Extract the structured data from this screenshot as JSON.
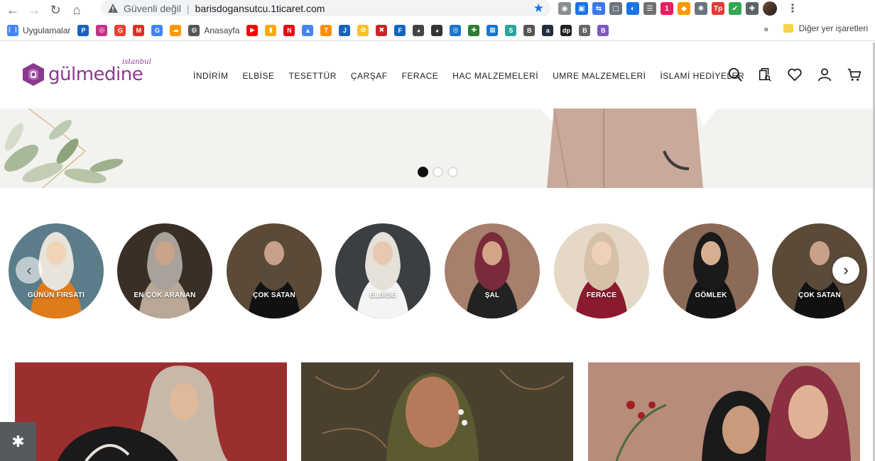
{
  "browser": {
    "nav": {
      "back": "←",
      "forward": "→",
      "reload": "↻",
      "home": "⌂"
    },
    "omnibox": {
      "security_label": "Güvenli değil",
      "separator": "|",
      "url": "barisdogansutcu.1ticaret.com",
      "star": "★"
    },
    "extensions": [
      {
        "name": "camera-ext-icon",
        "color": "#8a8f94",
        "glyph": "◉"
      },
      {
        "name": "screenshot-ext-icon",
        "color": "#1a73e8",
        "glyph": "▣"
      },
      {
        "name": "translate-ext-icon",
        "color": "#3b78e7",
        "glyph": "⇆"
      },
      {
        "name": "window-ext-icon",
        "color": "#6c757d",
        "glyph": "▢"
      },
      {
        "name": "edge-ext-icon",
        "color": "#1a73e8",
        "glyph": "◐"
      },
      {
        "name": "dark-ext-icon",
        "color": "#707070",
        "glyph": "☰"
      },
      {
        "name": "badge-ext-icon",
        "color": "#e91e63",
        "glyph": "1"
      },
      {
        "name": "cube-ext-icon",
        "color": "#ff9800",
        "glyph": "◆"
      },
      {
        "name": "gear-ext-icon",
        "color": "#6c757d",
        "glyph": "✺"
      },
      {
        "name": "tp-ext-icon",
        "color": "#e53935",
        "glyph": "Tp"
      },
      {
        "name": "shield-ext-icon",
        "color": "#34a853",
        "glyph": "✔"
      },
      {
        "name": "puzzle-ext-icon",
        "color": "#5f6368",
        "glyph": "✚"
      }
    ],
    "menu": "⋮",
    "bookmarks": [
      {
        "name": "apps-bookmark",
        "label": "Uygulamalar",
        "color": "#4285f4",
        "glyph": "⋮⋮"
      },
      {
        "name": "bookmark-1",
        "label": "",
        "color": "#1565c0",
        "glyph": "P"
      },
      {
        "name": "instagram-bookmark",
        "label": "",
        "color": "#c13584",
        "glyph": "◎"
      },
      {
        "name": "google-bookmark",
        "label": "",
        "color": "#ea4335",
        "glyph": "G"
      },
      {
        "name": "gmail-bookmark",
        "label": "",
        "color": "#d93025",
        "glyph": "M"
      },
      {
        "name": "translate-bookmark",
        "label": "",
        "color": "#4285f4",
        "glyph": "G"
      },
      {
        "name": "cloud-bookmark",
        "label": "",
        "color": "#ff9800",
        "glyph": "☁"
      },
      {
        "name": "anasayfa-bookmark",
        "label": "Anasayfa",
        "color": "#555",
        "glyph": "◍"
      },
      {
        "name": "youtube-bookmark",
        "label": "",
        "color": "#ff0000",
        "glyph": "▶"
      },
      {
        "name": "analytics-bookmark",
        "label": "",
        "color": "#f9ab00",
        "glyph": "▮"
      },
      {
        "name": "netflix-bookmark",
        "label": "",
        "color": "#e50914",
        "glyph": "N"
      },
      {
        "name": "ads-bookmark",
        "label": "",
        "color": "#4285f4",
        "glyph": "▲"
      },
      {
        "name": "t-bookmark",
        "label": "",
        "color": "#ff8f00",
        "glyph": "T"
      },
      {
        "name": "j-bookmark",
        "label": "",
        "color": "#1565c0",
        "glyph": "J"
      },
      {
        "name": "paw-bookmark",
        "label": "",
        "color": "#fbc02d",
        "glyph": "✿"
      },
      {
        "name": "red-bookmark",
        "label": "",
        "color": "#c62828",
        "glyph": "✖"
      },
      {
        "name": "f-bookmark",
        "label": "",
        "color": "#1565c0",
        "glyph": "F"
      },
      {
        "name": "ghost-bookmark",
        "label": "",
        "color": "#444",
        "glyph": "◕"
      },
      {
        "name": "ghost2-bookmark",
        "label": "",
        "color": "#333",
        "glyph": "◕"
      },
      {
        "name": "circle-bookmark",
        "label": "",
        "color": "#1976d2",
        "glyph": "◎"
      },
      {
        "name": "plus-bookmark",
        "label": "",
        "color": "#2e7d32",
        "glyph": "✚"
      },
      {
        "name": "grid-bookmark",
        "label": "",
        "color": "#1976d2",
        "glyph": "▦"
      },
      {
        "name": "s-bookmark",
        "label": "",
        "color": "#26a69a",
        "glyph": "S"
      },
      {
        "name": "b1-bookmark",
        "label": "",
        "color": "#555",
        "glyph": "B"
      },
      {
        "name": "amazon-bookmark",
        "label": "",
        "color": "#232f3e",
        "glyph": "a"
      },
      {
        "name": "dp-bookmark",
        "label": "",
        "color": "#222",
        "glyph": "dp"
      },
      {
        "name": "b2-bookmark",
        "label": "",
        "color": "#666",
        "glyph": "B"
      },
      {
        "name": "b3-bookmark",
        "label": "",
        "color": "#7e57c2",
        "glyph": "B"
      }
    ],
    "bookmarks_more": "»",
    "other_bookmarks": "Diğer yer işaretleri"
  },
  "site": {
    "logo": {
      "text": "gülmedine",
      "sub": "istanbul"
    },
    "menu": [
      "İNDİRİM",
      "ELBİSE",
      "TESETTÜR",
      "ÇARŞAF",
      "FERACE",
      "HAC MALZEMELERİ",
      "UMRE MALZEMELERİ",
      "İSLAMİ HEDİYELER"
    ],
    "header_icons": [
      "search-icon",
      "order-track-icon",
      "heart-icon",
      "user-icon",
      "cart-icon"
    ],
    "hero": {
      "slides": 3,
      "active": 1
    },
    "categories": [
      {
        "label": "GÜNÜN FIRSATI",
        "bg": "#e07b1a",
        "face": "#f0d4b8",
        "scarf": "#e8e4dc",
        "back": "#5b7d8a"
      },
      {
        "label": "EN ÇOK ARANAN",
        "bg": "#b9a897",
        "face": "#c9a38a",
        "scarf": "#a8a29b",
        "back": "#3a2f27"
      },
      {
        "label": "ÇOK SATAN",
        "bg": "#111",
        "face": "#c9a08a",
        "scarf": "#5a4a3a",
        "back": "#5a4a37"
      },
      {
        "label": "ELBİSE",
        "bg": "#f4f4f4",
        "face": "#e8c8b0",
        "scarf": "#e5e0d8",
        "back": "#3a3f44"
      },
      {
        "label": "ŞAL",
        "bg": "#222",
        "face": "#d4a487",
        "scarf": "#7a2a3a",
        "back": "#a77f6d"
      },
      {
        "label": "FERACE",
        "bg": "#8b1a2e",
        "face": "#f0d0b8",
        "scarf": "#d6c0a8",
        "back": "#e5d8c7"
      },
      {
        "label": "GÖMLEK",
        "bg": "#151515",
        "face": "#d8ad90",
        "scarf": "#1a1a1a",
        "back": "#8c6a58"
      },
      {
        "label": "ÇOK SATAN",
        "bg": "#111",
        "face": "#c9a08a",
        "scarf": "#5a4a3a",
        "back": "#5a4a37"
      }
    ],
    "carousel_prev": "‹",
    "carousel_next": "›",
    "banners": [
      {
        "name": "banner-1",
        "bg": "#9b2f2e"
      },
      {
        "name": "banner-2",
        "bg": "#4a4030"
      },
      {
        "name": "banner-3",
        "bg": "#b88c7a"
      }
    ],
    "settings_glyph": "✱",
    "colors": {
      "brand": "#8b3a8f",
      "text": "#222222"
    }
  }
}
